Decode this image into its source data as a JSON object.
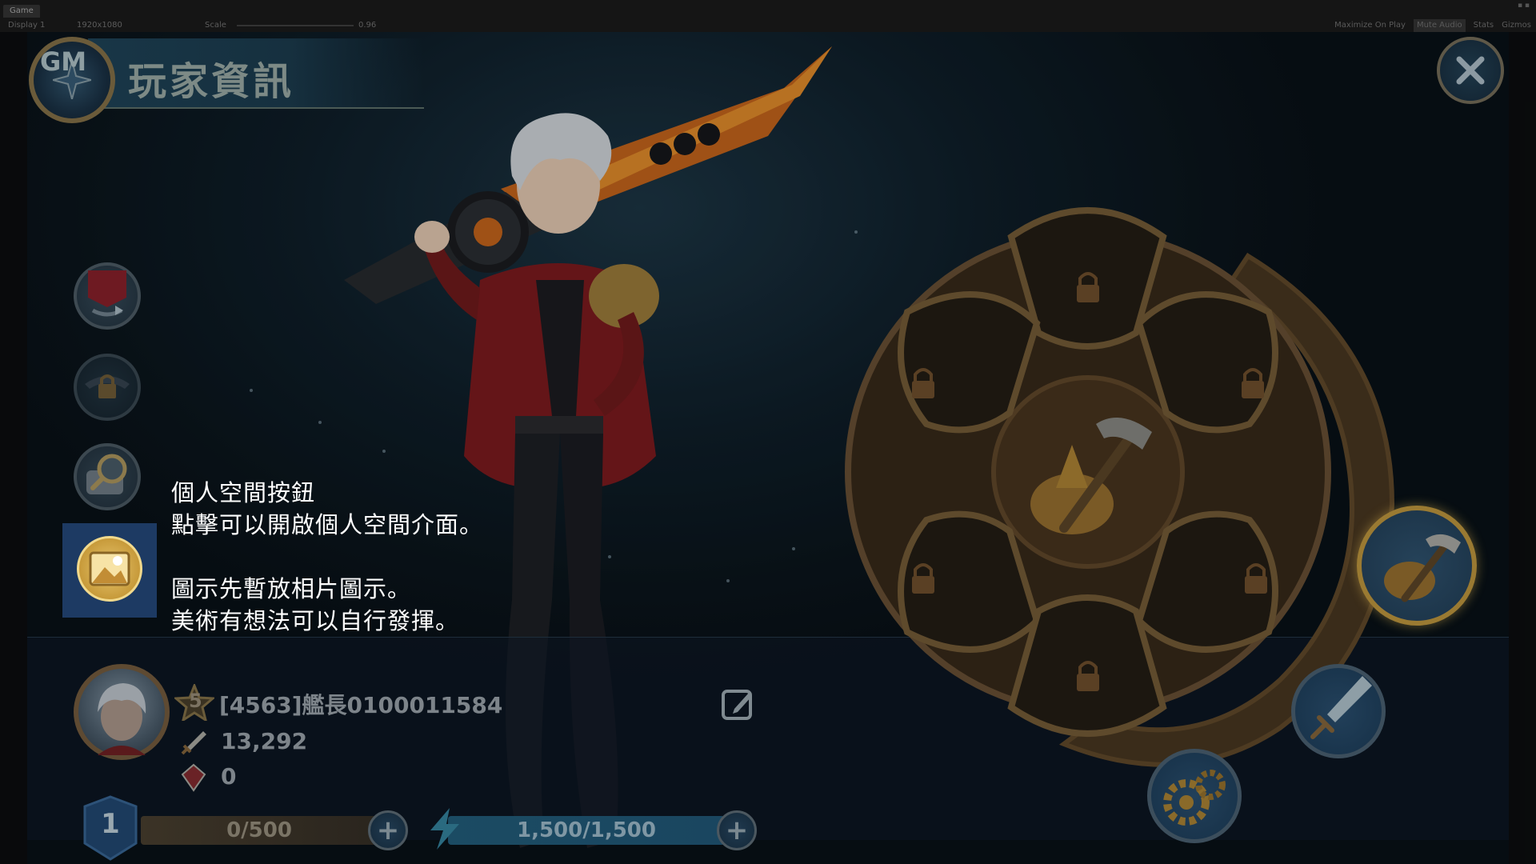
{
  "editor": {
    "tab_label": "Game",
    "display": "Display 1",
    "resolution": "1920x1080",
    "scale_label": "Scale",
    "scale_value": "0.96",
    "toggles": [
      "Maximize On Play",
      "Mute Audio",
      "Stats",
      "Gizmos"
    ]
  },
  "header": {
    "gm_label": "GM",
    "title": "玩家資訊"
  },
  "annotation": {
    "line1": "個人空間按鈕",
    "line2": "點擊可以開啟個人空間介面。",
    "line3": "圖示先暫放相片圖示。",
    "line4": "美術有想法可以自行發揮。"
  },
  "player": {
    "star_rank": "5",
    "name": "[4563]艦長0100011584",
    "power": "13,292",
    "gems": "0",
    "level": "1",
    "exp": "0/500",
    "energy": "1,500/1,500"
  },
  "colors": {
    "accent_gold": "#c79a3a",
    "highlight_blue": "#1d3a63",
    "panel_text": "#7d848a"
  },
  "icons": {
    "side_buttons": [
      "banner-icon",
      "locked-emblem-icon",
      "magnifier-scroll-icon",
      "photo-icon"
    ],
    "wheel_slots": [
      "lock-icon",
      "lock-icon",
      "lock-icon",
      "lock-icon",
      "lock-icon",
      "lock-icon"
    ],
    "wheel_center": "hammer-ore-icon",
    "actions": [
      "hammer-ore-icon",
      "sword-icon",
      "gears-icon"
    ]
  }
}
